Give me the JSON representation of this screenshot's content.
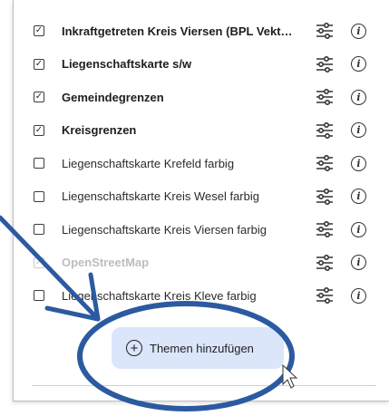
{
  "layers": [
    {
      "label": "Inkraftgetreten Kreis Viersen (BPL Vekt…",
      "checked": true,
      "bold": true,
      "disabled": false
    },
    {
      "label": "Liegenschaftskarte s/w",
      "checked": true,
      "bold": true,
      "disabled": false
    },
    {
      "label": "Gemeindegrenzen",
      "checked": true,
      "bold": true,
      "disabled": false
    },
    {
      "label": "Kreisgrenzen",
      "checked": true,
      "bold": true,
      "disabled": false
    },
    {
      "label": "Liegenschaftskarte Krefeld farbig",
      "checked": false,
      "bold": false,
      "disabled": false
    },
    {
      "label": "Liegenschaftskarte Kreis Wesel farbig",
      "checked": false,
      "bold": false,
      "disabled": false
    },
    {
      "label": "Liegenschaftskarte Kreis Viersen farbig",
      "checked": false,
      "bold": false,
      "disabled": false
    },
    {
      "label": "OpenStreetMap",
      "checked": true,
      "bold": true,
      "disabled": true
    },
    {
      "label": "Liegenschaftskarte Kreis Kleve farbig",
      "checked": false,
      "bold": false,
      "disabled": false
    }
  ],
  "add_button": {
    "label": "Themen hinzufügen",
    "icon": "plus-circle-icon"
  },
  "row_icons": {
    "settings": "tune-icon",
    "info": "info-icon"
  },
  "annotation": {
    "color": "#2c5aa0"
  },
  "colors": {
    "button_bg": "#dbe6fb"
  }
}
